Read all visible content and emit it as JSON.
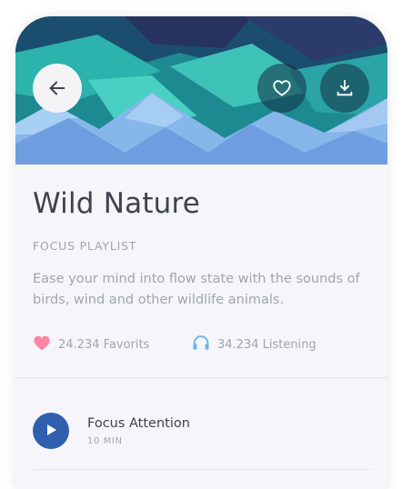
{
  "header": {
    "back_icon": "arrow-left-icon",
    "favorite_icon": "heart-outline-icon",
    "download_icon": "download-icon"
  },
  "playlist": {
    "title": "Wild Nature",
    "category": "FOCUS PLAYLIST",
    "description": "Ease your mind into flow state with the sounds of birds, wind and other wildlife animals."
  },
  "stats": {
    "favorites": "24.234 Favorits",
    "listening": "34.234 Listening"
  },
  "tracks": [
    {
      "title": "Focus Attention",
      "duration": "10 MIN"
    }
  ],
  "colors": {
    "heart": "#ff84a2",
    "headphones": "#6cb6f0",
    "play": "#2f5fae",
    "title_text": "#3f414e",
    "muted_text": "#a1a4b2"
  }
}
